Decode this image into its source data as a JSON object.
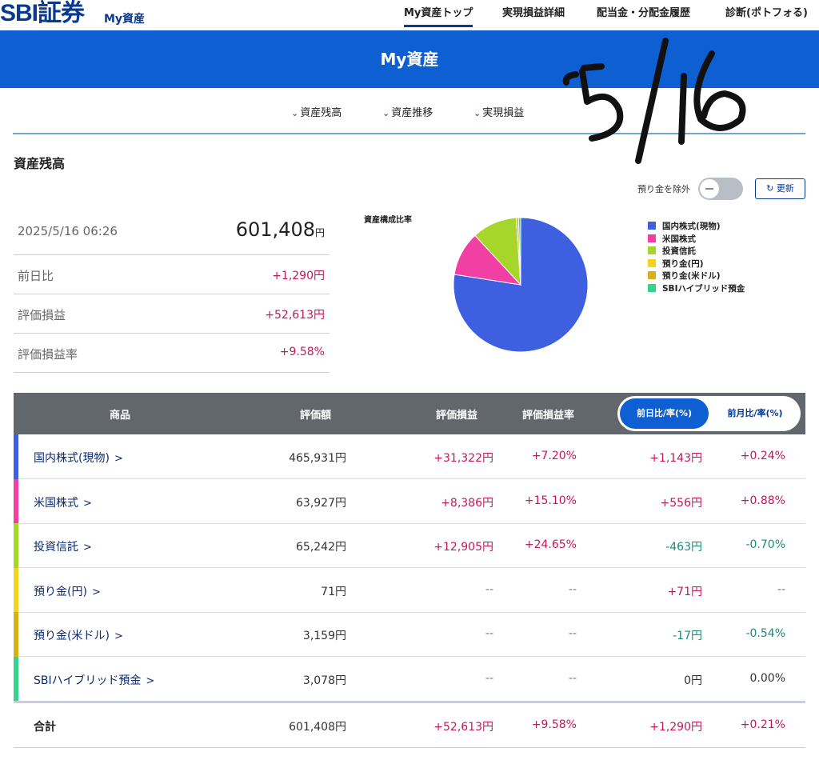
{
  "header": {
    "logo": "SBI証券",
    "logo_sub": "My資産",
    "nav": [
      "My資産トップ",
      "実現損益詳細",
      "配当金・分配金履歴",
      "診断(ポトフォる)"
    ]
  },
  "banner_title": "My資産",
  "subnav": [
    "資産残高",
    "資産推移",
    "実現損益"
  ],
  "handwritten_note": "5/16",
  "section_title": "資産残高",
  "toggle_label": "預り金を除外",
  "refresh_label": "更新",
  "summary": {
    "datetime": "2025/5/16 06:26",
    "total": "601,408",
    "total_unit": "円",
    "rows": [
      {
        "label": "前日比",
        "value": "+1,290円"
      },
      {
        "label": "評価損益",
        "value": "+52,613円"
      },
      {
        "label": "評価損益率",
        "value": "+9.58%"
      }
    ]
  },
  "pie_title": "資産構成比率",
  "chart_data": {
    "type": "pie",
    "title": "資産構成比率",
    "slices": [
      {
        "name": "国内株式(現物)",
        "value": 465931,
        "color": "#3d5fe0"
      },
      {
        "name": "米国株式",
        "value": 63927,
        "color": "#f23fa3"
      },
      {
        "name": "投資信託",
        "value": 65242,
        "color": "#a6d62a"
      },
      {
        "name": "預り金(円)",
        "value": 71,
        "color": "#f2d41f"
      },
      {
        "name": "預り金(米ドル)",
        "value": 3159,
        "color": "#d6b21a"
      },
      {
        "name": "SBIハイブリッド預金",
        "value": 3078,
        "color": "#36d38c"
      }
    ]
  },
  "table": {
    "headers": [
      "商品",
      "評価額",
      "評価損益",
      "評価損益率"
    ],
    "toggle_active": "前日比/率(%)",
    "toggle_inactive": "前月比/率(%)",
    "rows": [
      {
        "name": "国内株式(現物)",
        "color": "#3d5fe0",
        "value": "465,931円",
        "pl": "+31,322円",
        "pl_rate": "+7.20%",
        "day": "+1,143円",
        "day_rate": "+0.24%",
        "day_cls": "pos",
        "rate_cls": "pos",
        "pl_cls": "pos"
      },
      {
        "name": "米国株式",
        "color": "#f23fa3",
        "value": "63,927円",
        "pl": "+8,386円",
        "pl_rate": "+15.10%",
        "day": "+556円",
        "day_rate": "+0.88%",
        "day_cls": "pos",
        "rate_cls": "pos",
        "pl_cls": "pos"
      },
      {
        "name": "投資信託",
        "color": "#a6d62a",
        "value": "65,242円",
        "pl": "+12,905円",
        "pl_rate": "+24.65%",
        "day": "-463円",
        "day_rate": "-0.70%",
        "day_cls": "neg",
        "rate_cls": "neg",
        "pl_cls": "pos"
      },
      {
        "name": "預り金(円)",
        "color": "#f2d41f",
        "value": "71円",
        "pl": "--",
        "pl_rate": "--",
        "day": "+71円",
        "day_rate": "--",
        "day_cls": "pos",
        "rate_cls": "dash",
        "pl_cls": "dash"
      },
      {
        "name": "預り金(米ドル)",
        "color": "#d6b21a",
        "value": "3,159円",
        "pl": "--",
        "pl_rate": "--",
        "day": "-17円",
        "day_rate": "-0.54%",
        "day_cls": "neg",
        "rate_cls": "neg",
        "pl_cls": "dash"
      },
      {
        "name": "SBIハイブリッド預金",
        "color": "#36d38c",
        "value": "3,078円",
        "pl": "--",
        "pl_rate": "--",
        "day": "0円",
        "day_rate": "0.00%",
        "day_cls": "neu",
        "rate_cls": "neu",
        "pl_cls": "dash"
      }
    ],
    "total": {
      "name": "合計",
      "value": "601,408円",
      "pl": "+52,613円",
      "pl_rate": "+9.58%",
      "day": "+1,290円",
      "day_rate": "+0.21%"
    }
  }
}
